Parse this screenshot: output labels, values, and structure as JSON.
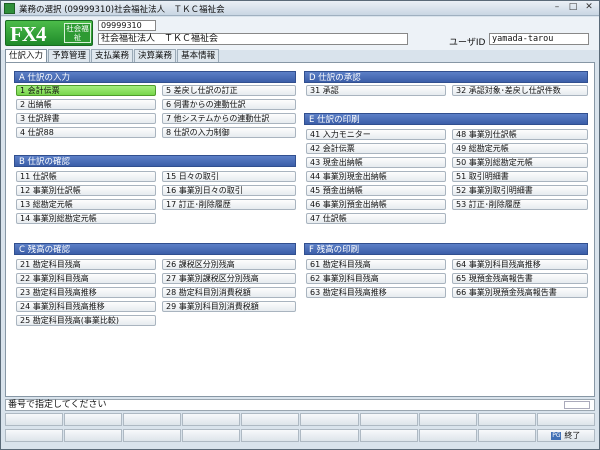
{
  "window": {
    "title": "業務の選択 (09999310)社会福祉法人　ＴＫＣ福祉会"
  },
  "header": {
    "logo_text": "FX4",
    "logo_tag": "社会福祉",
    "code": "09999310",
    "org_name": "社会福祉法人　ＴＫＣ福祉会",
    "user_label": "ユーザID",
    "user_id": "yamada-tarou"
  },
  "tabs": [
    "仕訳入力",
    "予算管理",
    "支払業務",
    "決算業務",
    "基本情報"
  ],
  "sections": {
    "A": {
      "title": "A 仕訳の入力",
      "items": [
        "1 会計伝票",
        "2 出納帳",
        "3 仕訳辞書",
        "4 仕訳88",
        "5 差戻し仕訳の訂正",
        "6 伺書からの連動仕訳",
        "7 他システムからの連動仕訳",
        "8 仕訳の入力制御"
      ]
    },
    "B": {
      "title": "B 仕訳の確認",
      "items": [
        "11 仕訳帳",
        "12 事業別仕訳帳",
        "13 総勘定元帳",
        "14 事業別総勘定元帳",
        "15 日々の取引",
        "16 事業別日々の取引",
        "17 訂正･削除履歴"
      ]
    },
    "C": {
      "title": "C 残高の確認",
      "items": [
        "21 勘定科目残高",
        "22 事業別科目残高",
        "23 勘定科目残高推移",
        "24 事業別科目残高推移",
        "25 勘定科目残高(事業比較)",
        "26 課税区分別残高",
        "27 事業別課税区分別残高",
        "28 勘定科目別消費税額",
        "29 事業別科目別消費税額"
      ]
    },
    "D": {
      "title": "D 仕訳の承認",
      "items": [
        "31 承認",
        "32 承認対象･差戻し仕訳件数"
      ]
    },
    "E": {
      "title": "E 仕訳の印刷",
      "items": [
        "41 入力モニター",
        "42 会計伝票",
        "43 現金出納帳",
        "44 事業別現金出納帳",
        "45 預金出納帳",
        "46 事業別預金出納帳",
        "47 仕訳帳",
        "48 事業別仕訳帳",
        "49 総勘定元帳",
        "50 事業別総勘定元帳",
        "51 取引明細書",
        "52 事業別取引明細書",
        "53 訂正･削除履歴"
      ]
    },
    "F": {
      "title": "F 残高の印刷",
      "items": [
        "61 勘定科目残高",
        "62 事業別科目残高",
        "63 勘定科目残高推移",
        "64 事業別科目残高推移",
        "65 現預金残高報告書",
        "66 事業別現預金残高報告書"
      ]
    }
  },
  "prompt": "番号で指定してください",
  "footer": {
    "end_key": "PG",
    "end_label": "終了"
  },
  "colors": {
    "section_header": "#3b5ea8",
    "selected_item": "#78d64b",
    "logo": "#1f8a2a"
  }
}
